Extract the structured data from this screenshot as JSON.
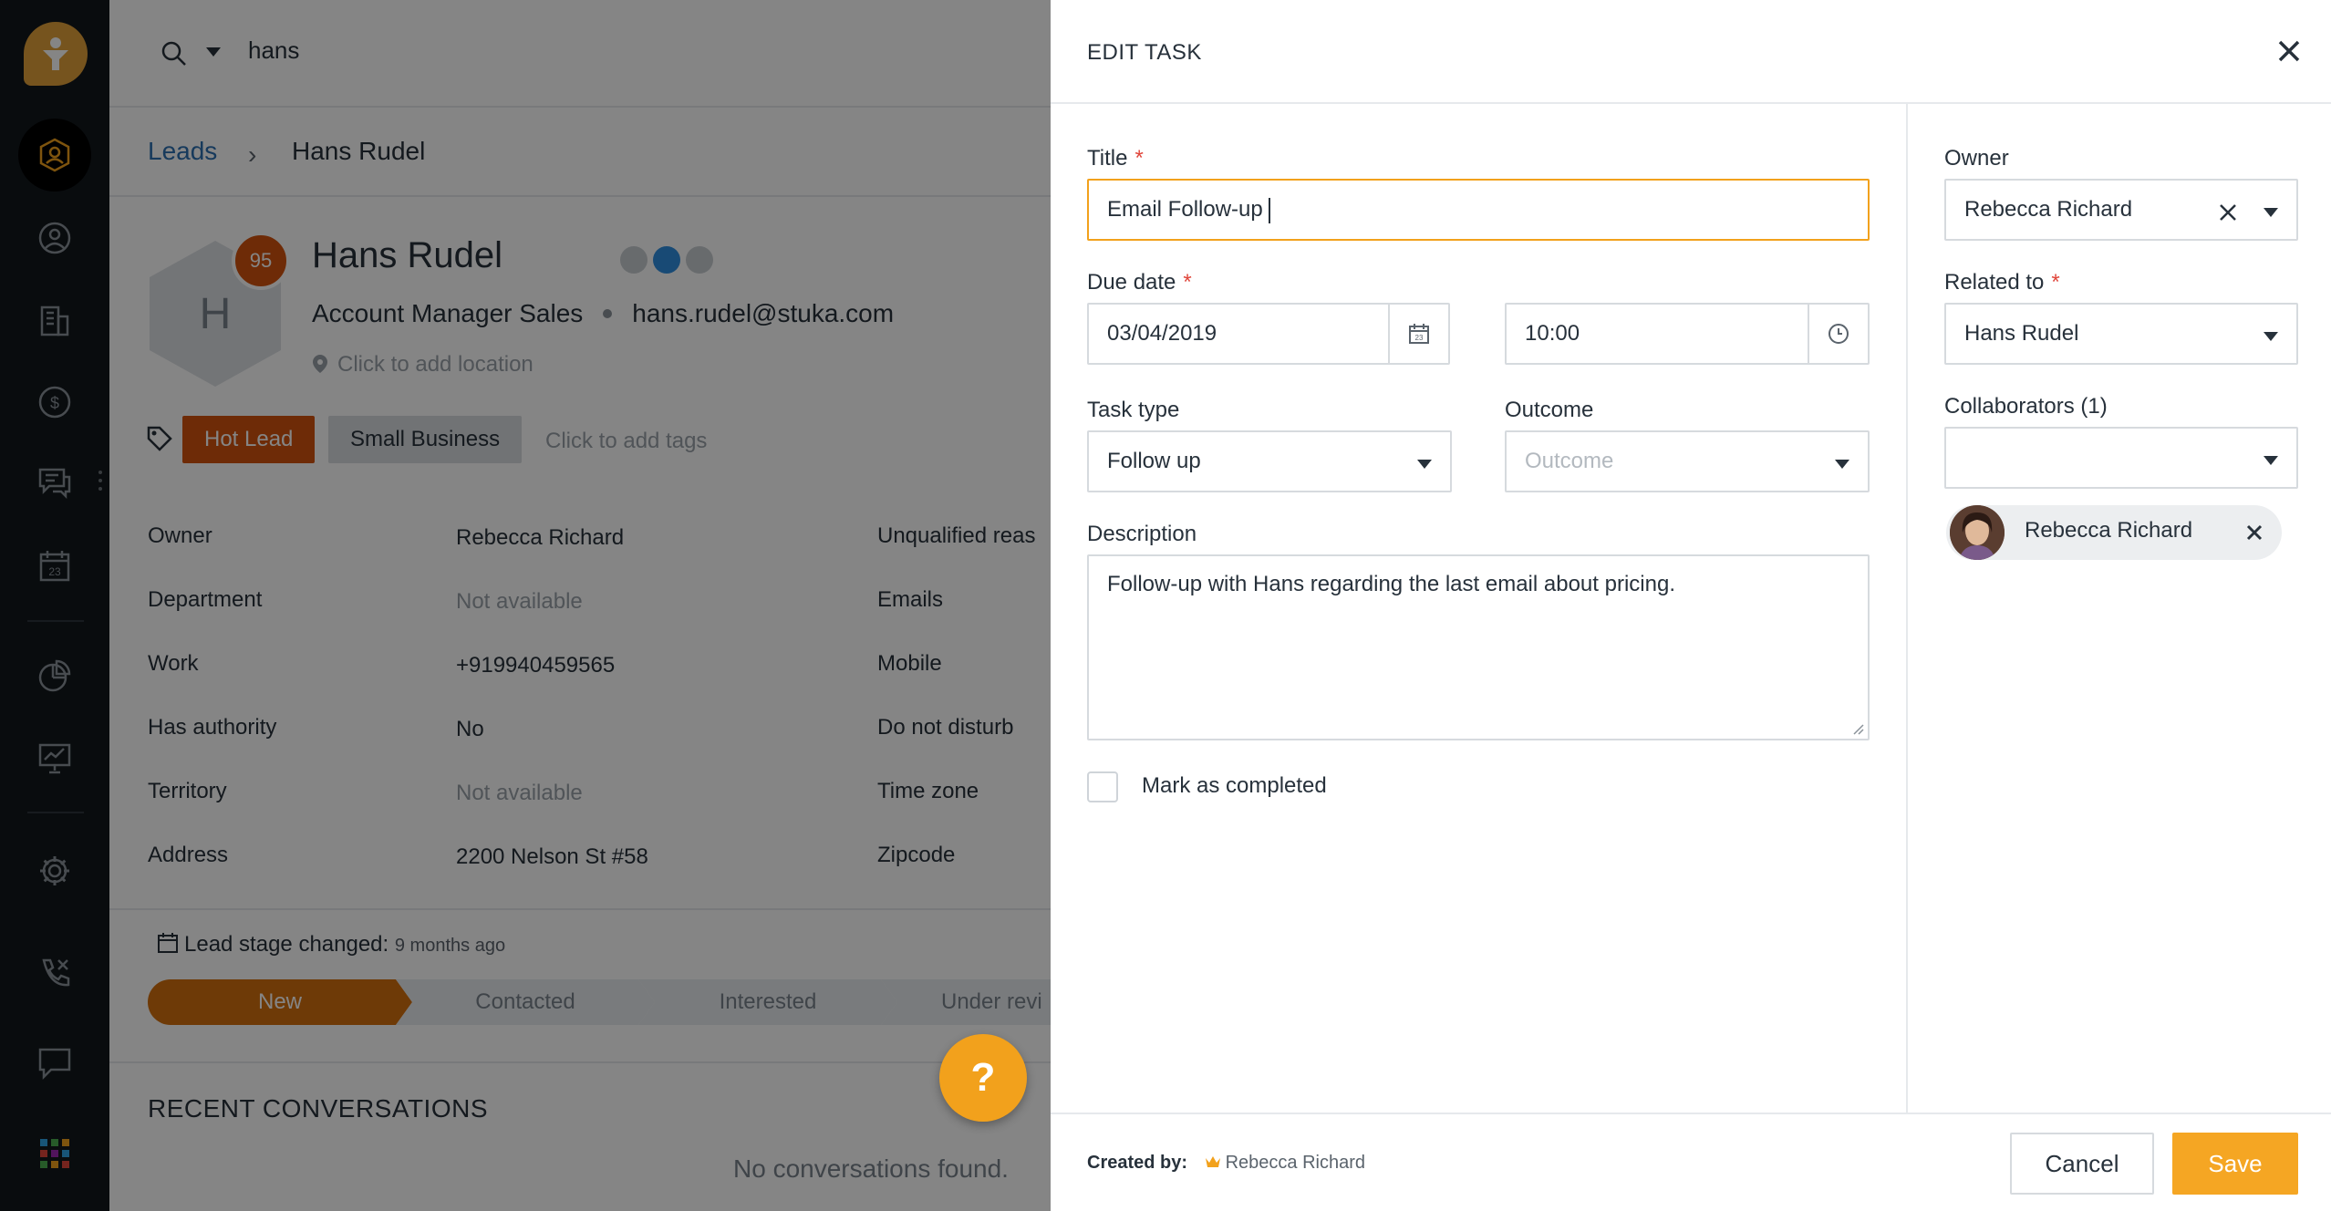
{
  "search": {
    "query": "hans"
  },
  "breadcrumb": {
    "parent": "Leads",
    "separator": "›",
    "current": "Hans Rudel"
  },
  "lead": {
    "avatar_initial": "H",
    "score": "95",
    "name": "Hans Rudel",
    "job_title": "Account Manager Sales",
    "email": "hans.rudel@stuka.com",
    "location_placeholder": "Click to add location",
    "tags": [
      "Hot Lead",
      "Small Business"
    ],
    "tags_placeholder": "Click to add tags"
  },
  "fields_left": [
    {
      "label": "Owner",
      "value": "Rebecca Richard",
      "muted": false
    },
    {
      "label": "Department",
      "value": "Not available",
      "muted": true
    },
    {
      "label": "Work",
      "value": "+919940459565",
      "muted": false
    },
    {
      "label": "Has authority",
      "value": "No",
      "muted": false
    },
    {
      "label": "Territory",
      "value": "Not available",
      "muted": true
    },
    {
      "label": "Address",
      "value": "2200 Nelson St #58",
      "muted": false
    }
  ],
  "fields_right": [
    "Unqualified reas",
    "Emails",
    "Mobile",
    "Do not disturb",
    "Time zone",
    "Zipcode"
  ],
  "stage": {
    "label": "Lead stage changed:",
    "when": "9 months ago",
    "steps": [
      "New",
      "Contacted",
      "Interested",
      "Under revi"
    ],
    "active_index": 0
  },
  "conversations": {
    "title": "RECENT CONVERSATIONS",
    "empty": "No conversations found."
  },
  "help_button": "?",
  "modal": {
    "title": "EDIT TASK",
    "title_label": "Title",
    "title_value": "Email Follow-up",
    "due_label": "Due date",
    "due_date": "03/04/2019",
    "due_time": "10:00",
    "task_type_label": "Task type",
    "task_type_value": "Follow up",
    "outcome_label": "Outcome",
    "outcome_placeholder": "Outcome",
    "description_label": "Description",
    "description_value": "Follow-up with Hans regarding the last email about pricing.",
    "completed_label": "Mark as completed",
    "owner_label": "Owner",
    "owner_value": "Rebecca Richard",
    "related_label": "Related to",
    "related_value": "Hans Rudel",
    "collaborators_label": "Collaborators (1)",
    "collaborators": [
      "Rebecca Richard"
    ],
    "created_by_label": "Created by:",
    "created_by_value": "Rebecca Richard",
    "cancel_label": "Cancel",
    "save_label": "Save"
  },
  "colors": {
    "accent": "#f5a623",
    "focus_border": "#f2a11c",
    "required": "#e0463b",
    "hot_tag": "#d4530e",
    "stage_active": "#d4700e",
    "nav_bg": "#12171c",
    "link": "#2c6fb0"
  },
  "icons": {
    "nav": [
      "logo-icon",
      "leads-icon",
      "contacts-icon",
      "accounts-icon",
      "deals-icon",
      "conversations-icon",
      "calendar-icon",
      "reports-icon",
      "presentation-icon",
      "settings-icon",
      "phone-icon",
      "chat-icon",
      "apps-grid-icon"
    ],
    "modal": [
      "close-icon",
      "calendar-icon",
      "clock-icon",
      "chevron-down-icon",
      "clear-icon",
      "crown-icon"
    ]
  }
}
